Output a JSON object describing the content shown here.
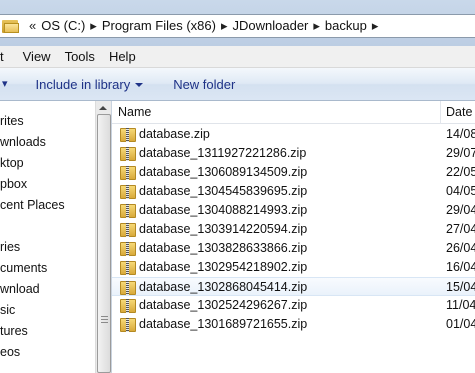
{
  "address": {
    "overflow_chevron": "«",
    "separator": "▸",
    "crumbs": [
      "OS (C:)",
      "Program Files (x86)",
      "JDownloader",
      "backup"
    ]
  },
  "menu": {
    "items": [
      "t",
      "View",
      "Tools",
      "Help"
    ]
  },
  "toolbar": {
    "organize_arrow": "▾",
    "include_label": "Include in library",
    "new_folder_label": "New folder"
  },
  "nav": {
    "items": [
      "rites",
      "wnloads",
      "ktop",
      "pbox",
      "cent Places",
      "ries",
      "cuments",
      "wnload",
      "sic",
      "tures",
      "eos"
    ]
  },
  "file_list": {
    "columns": {
      "name": "Name",
      "date": "Date m"
    },
    "hover_index": 8,
    "rows": [
      {
        "name": "database.zip",
        "date": "14/08"
      },
      {
        "name": "database_1311927221286.zip",
        "date": "29/07"
      },
      {
        "name": "database_1306089134509.zip",
        "date": "22/05"
      },
      {
        "name": "database_1304545839695.zip",
        "date": "04/05"
      },
      {
        "name": "database_1304088214993.zip",
        "date": "29/04"
      },
      {
        "name": "database_1303914220594.zip",
        "date": "27/04"
      },
      {
        "name": "database_1303828633866.zip",
        "date": "26/04"
      },
      {
        "name": "database_1302954218902.zip",
        "date": "16/04"
      },
      {
        "name": "database_1302868045414.zip",
        "date": "15/04"
      },
      {
        "name": "database_1302524296267.zip",
        "date": "11/04"
      },
      {
        "name": "database_1301689721655.zip",
        "date": "01/04"
      }
    ]
  },
  "colors": {
    "toolbar_text": "#1e3287",
    "hover_row": "#eaf2fb",
    "window_frame": "#cfdcec"
  }
}
